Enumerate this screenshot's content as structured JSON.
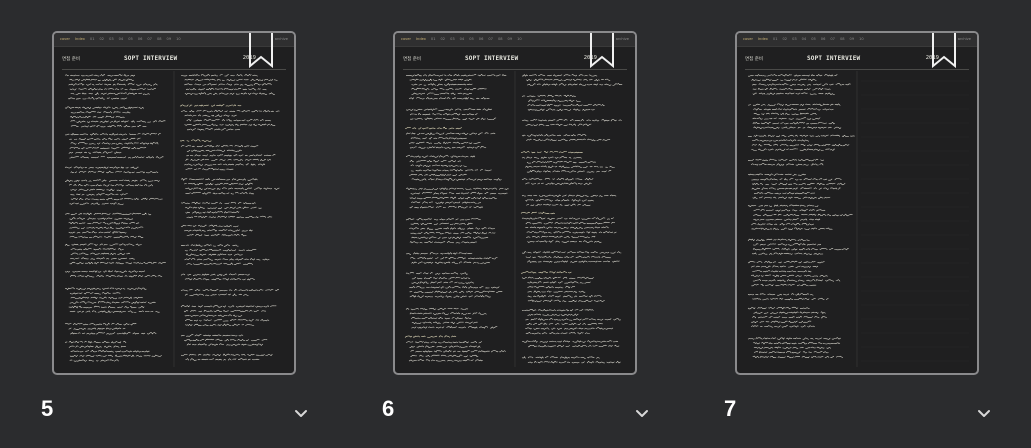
{
  "pages": [
    {
      "page_number": "5",
      "tabs": [
        "cover",
        "Index",
        "01",
        "02",
        "03",
        "04",
        "05",
        "06",
        "07",
        "08",
        "09",
        "10"
      ],
      "tab_right": "archive",
      "doc_label": "면접 준비",
      "doc_title": "SOPT INTERVIEW",
      "doc_year": "2019"
    },
    {
      "page_number": "6",
      "tabs": [
        "cover",
        "Index",
        "01",
        "02",
        "03",
        "04",
        "05",
        "06",
        "07",
        "08",
        "09",
        "10"
      ],
      "tab_right": "archive",
      "doc_label": "면접 준비",
      "doc_title": "SOPT INTERVIEW",
      "doc_year": "2019"
    },
    {
      "page_number": "7",
      "tabs": [
        "cover",
        "Index",
        "01",
        "02",
        "03",
        "04",
        "05",
        "06",
        "07",
        "08",
        "09",
        "10"
      ],
      "tab_right": "archive",
      "doc_label": "면접 준비",
      "doc_title": "SOPT INTERVIEW",
      "doc_year": "2019"
    }
  ],
  "colors": {
    "background": "#2b2c2e",
    "page": "#1f1f20",
    "border": "#8a8a8c",
    "accent": "#c9b277",
    "ink": "#e6e6e0"
  },
  "icons": {
    "bookmark": "bookmark-icon",
    "expand": "chevron-down-icon"
  }
}
